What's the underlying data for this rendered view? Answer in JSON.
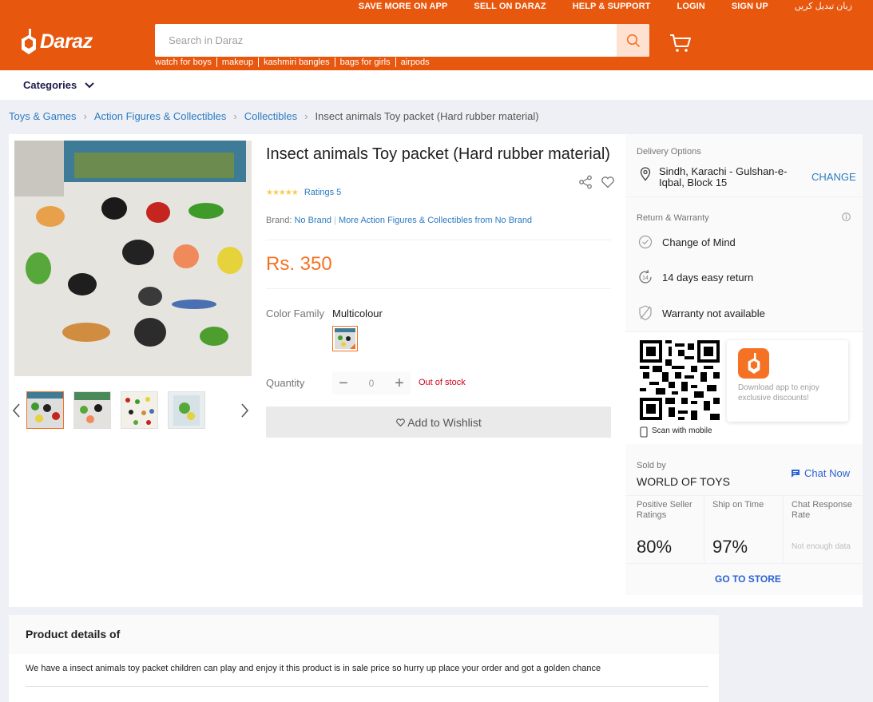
{
  "header": {
    "top_links": [
      "SAVE MORE ON APP",
      "SELL ON DARAZ",
      "HELP & SUPPORT",
      "LOGIN",
      "SIGN UP",
      "زبان تبدیل کریں"
    ],
    "logo_text": "Daraz",
    "search_placeholder": "Search in Daraz",
    "suggestions": [
      "watch for boys",
      "makeup",
      "kashmiri bangles",
      "bags for girls",
      "airpods"
    ]
  },
  "categories_label": "Categories",
  "breadcrumb": [
    "Toys & Games",
    "Action Figures & Collectibles",
    "Collectibles",
    "Insect animals Toy packet (Hard rubber material)"
  ],
  "product": {
    "title": "Insect animals Toy packet (Hard rubber material)",
    "stars": "★★★★★",
    "ratings_text": "Ratings 5",
    "brand_label": "Brand:",
    "brand": "No Brand",
    "more_from": "More Action Figures & Collectibles from No Brand",
    "price": "Rs. 350",
    "color_label": "Color Family",
    "color_value": "Multicolour",
    "quantity_label": "Quantity",
    "quantity": "0",
    "qty_minus": "−",
    "qty_plus": "+",
    "stock_status": "Out of stock",
    "wishlist_label": "Add to Wishlist"
  },
  "delivery": {
    "section_title": "Delivery Options",
    "location": "Sindh, Karachi - Gulshan-e-Iqbal, Block 15",
    "change_label": "CHANGE"
  },
  "returns": {
    "section_title": "Return & Warranty",
    "items": [
      "Change of Mind",
      "14 days easy return",
      "Warranty not available"
    ]
  },
  "app_promo": {
    "text": "Download app to enjoy exclusive discounts!",
    "scan_label": "Scan with mobile"
  },
  "seller": {
    "sold_by_label": "Sold by",
    "name": "WORLD OF TOYS",
    "chat_label": "Chat Now",
    "stats": [
      {
        "title": "Positive Seller Ratings",
        "value": "80%"
      },
      {
        "title": "Ship on Time",
        "value": "97%"
      },
      {
        "title": "Chat Response Rate",
        "value": "Not enough data"
      }
    ],
    "go_to_store": "GO TO STORE"
  },
  "details": {
    "title": "Product details of",
    "description": "We have a insect animals toy packet children can play and enjoy it this product is in sale price so hurry up place your order and got a golden chance"
  },
  "colors": {
    "brand_orange": "#e8570e",
    "price_orange": "#f57224",
    "link_blue": "#2b7bc1",
    "out_of_stock_red": "#d0011b"
  }
}
